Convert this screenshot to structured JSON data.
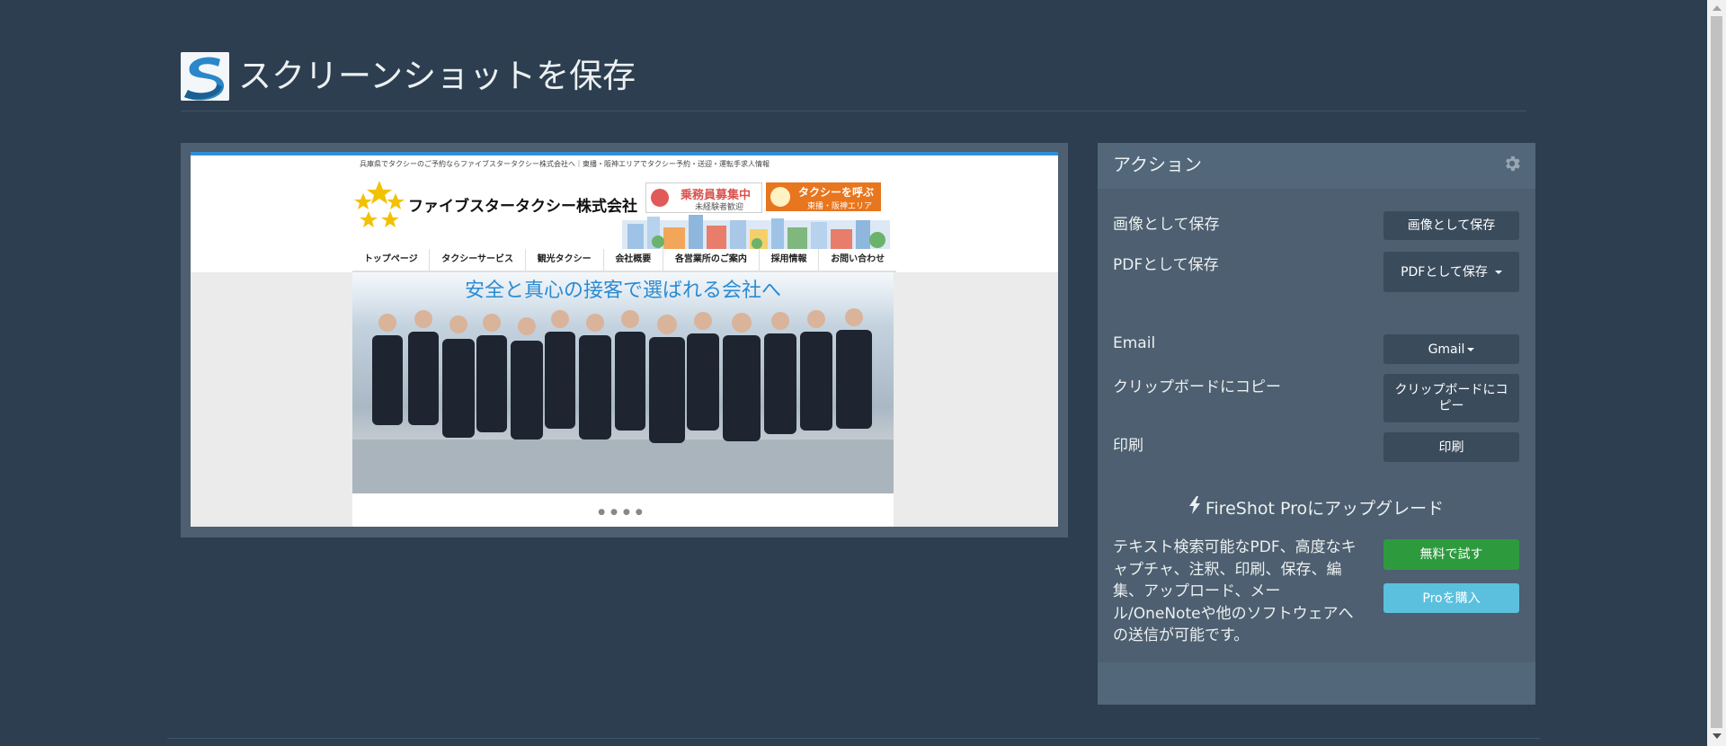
{
  "header": {
    "title": "スクリーンショットを保存",
    "logo_icon": "fireshot-s-logo-icon"
  },
  "preview": {
    "tagline": "兵庫県でタクシーのご予約ならファイブスタータクシー株式会社へ｜東播・阪神エリアでタクシー予約・送迎・運転手求人情報",
    "company_name": "ファイブスタータクシー株式会社",
    "badge_recruit": {
      "title": "乗務員募集中",
      "sub": "未経験者歓迎"
    },
    "badge_call": {
      "title": "タクシーを呼ぶ",
      "sub": "東播・阪神エリア"
    },
    "nav": [
      "トップページ",
      "タクシーサービス",
      "観光タクシー",
      "会社概要",
      "各営業所のご案内",
      "採用情報",
      "お問い合わせ"
    ],
    "slogan": "安全と真心の接客で選ばれる会社へ",
    "dots": "●●●●",
    "accent": "#2f8fd8"
  },
  "actions": {
    "title": "アクション",
    "settings_icon": "gear-icon",
    "rows": {
      "save_image": {
        "label": "画像として保存",
        "button": "画像として保存"
      },
      "save_pdf": {
        "label": "PDFとして保存",
        "button": "PDFとして保存"
      },
      "email": {
        "label": "Email",
        "button": "Gmail"
      },
      "clipboard": {
        "label": "クリップボードにコピー",
        "button": "クリップボードにコピー"
      },
      "print": {
        "label": "印刷",
        "button": "印刷"
      }
    },
    "upgrade": {
      "title": "FireShot Proにアップグレード",
      "icon": "bolt-icon",
      "description": "テキスト検索可能なPDF、高度なキャプチャ、注釈、印刷、保存、編集、アップロード、メール/OneNoteや他のソフトウェアへの送信が可能です。",
      "try_button": "無料で試す",
      "buy_button": "Proを購入"
    },
    "colors": {
      "green": "#2e9a3e",
      "blue": "#5bc0de",
      "panel": "#4d5f70",
      "background": "#2c3e50"
    }
  }
}
